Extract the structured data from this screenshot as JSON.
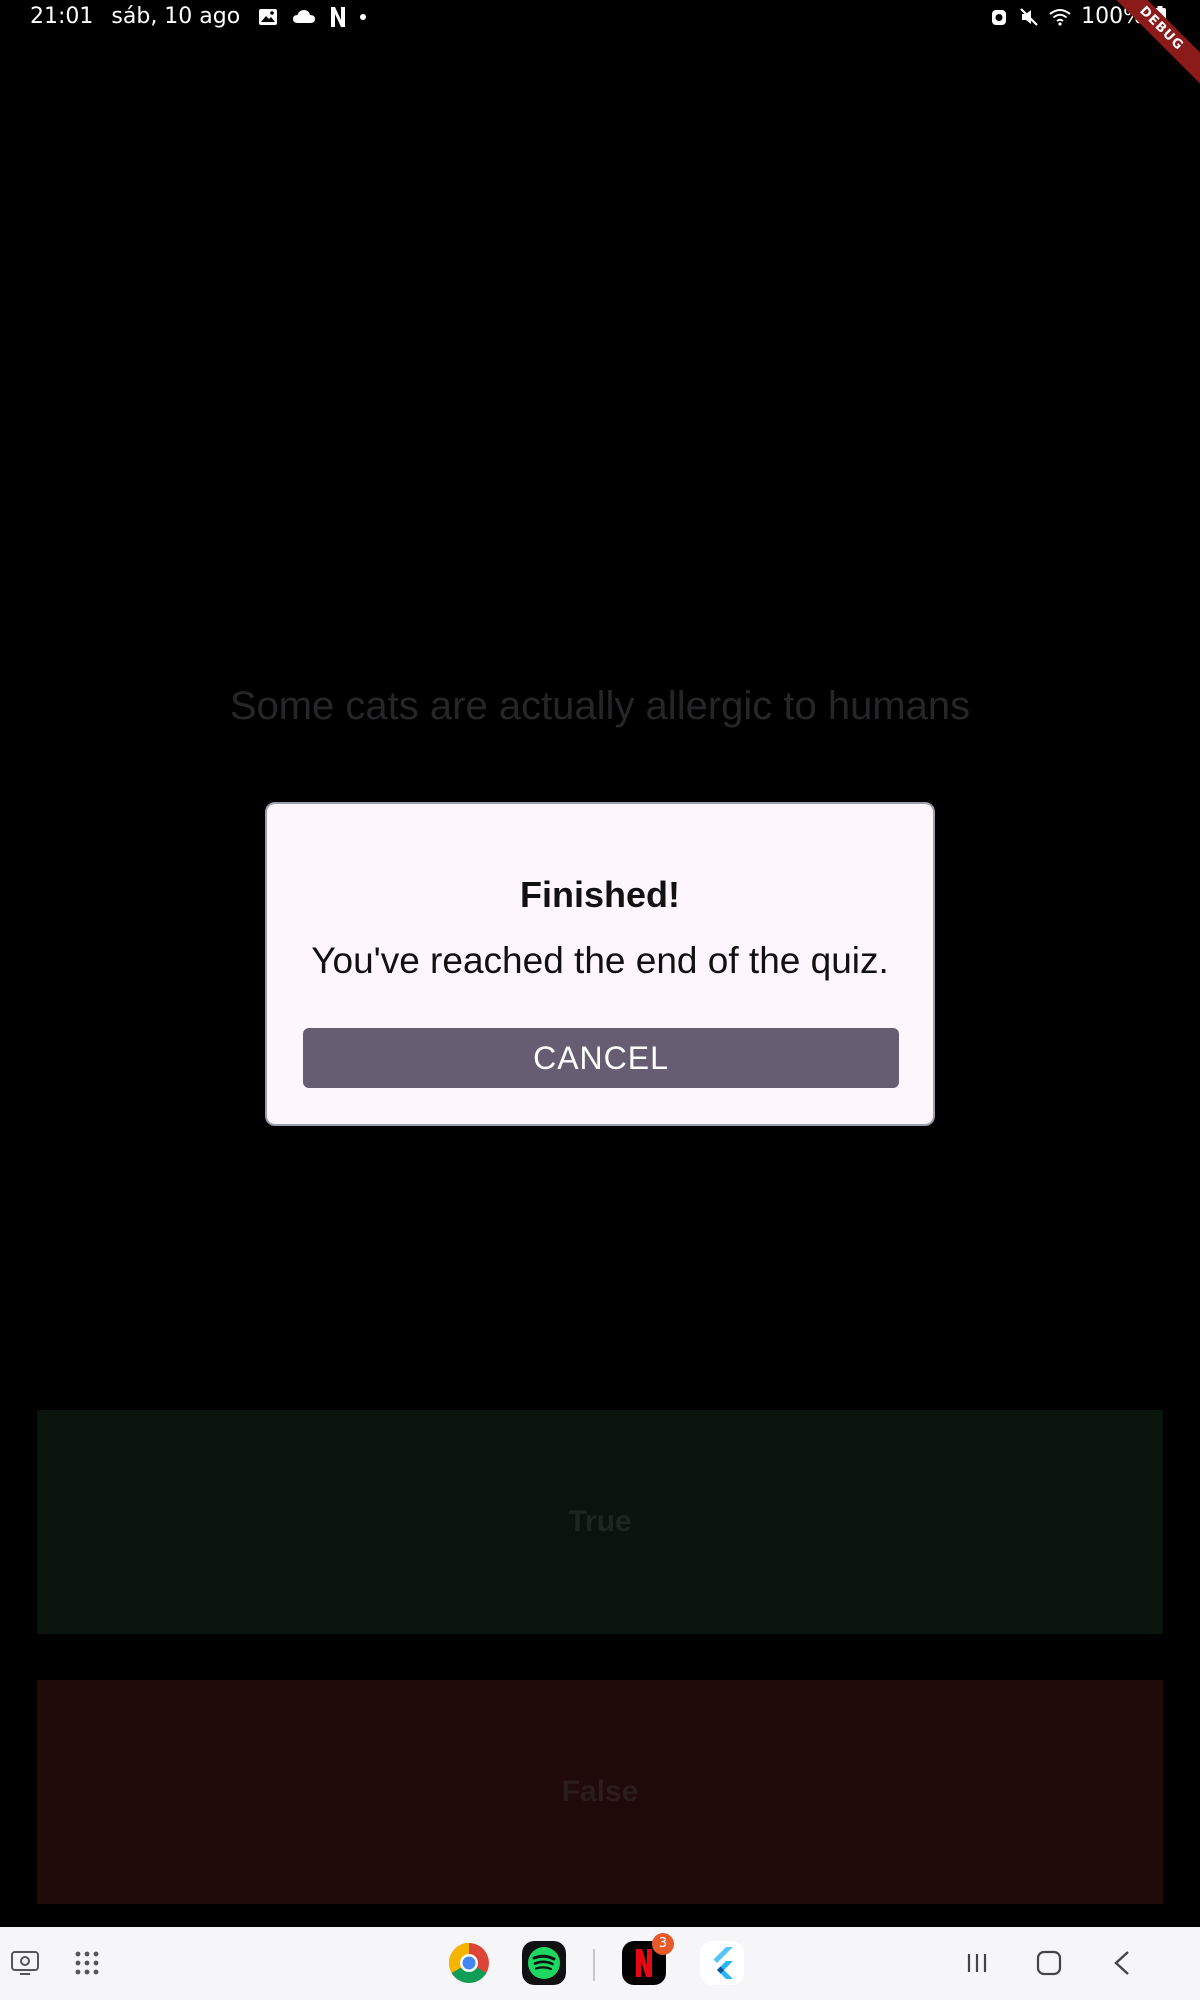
{
  "status_bar": {
    "time": "21:01",
    "date": "sáb, 10 ago",
    "battery": "100%",
    "left_icons": [
      "image-icon",
      "cloud-icon",
      "netflix-n-icon",
      "notification-dot-icon"
    ],
    "right_icons": [
      "alarm-icon",
      "mute-icon",
      "wifi-icon",
      "battery-icon"
    ]
  },
  "debug_banner": "DEBUG",
  "quiz": {
    "question": "Some cats are actually allergic to humans",
    "true_label": "True",
    "false_label": "False"
  },
  "dialog": {
    "title": "Finished!",
    "message": "You've reached the end of the quiz.",
    "cancel_label": "CANCEL"
  },
  "taskbar": {
    "apps": [
      "chrome-icon",
      "spotify-icon",
      "netflix-icon",
      "flutter-icon"
    ],
    "netflix_badge": "3"
  },
  "colors": {
    "dialog_bg": "#fdf7fd",
    "cancel_button": "#665d73",
    "true_bg": "#0a140d",
    "false_bg": "#200a0a"
  }
}
